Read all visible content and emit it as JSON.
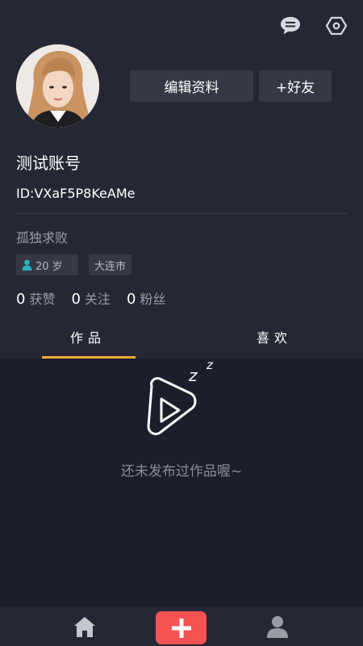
{
  "header": {
    "message_icon": "chat-bubble-icon",
    "settings_icon": "hexagon-settings-icon"
  },
  "profile": {
    "avatar": "user-avatar-photo",
    "edit_button": "编辑资料",
    "add_friend_button": "+好友",
    "nickname": "测试账号",
    "id": "ID:VXaF5P8KeAMe",
    "signature": "孤独求败",
    "age_tag": "20 岁",
    "city_tag": "大连市",
    "stats": [
      {
        "num": "0",
        "label": "获赞"
      },
      {
        "num": "0",
        "label": "关注"
      },
      {
        "num": "0",
        "label": "粉丝"
      }
    ]
  },
  "tabs": [
    {
      "label": "作品",
      "active": true
    },
    {
      "label": "喜欢",
      "active": false
    }
  ],
  "empty_state": {
    "text": "还未发布过作品喔~",
    "icon": "sleeping-play-icon"
  },
  "bottom_nav": {
    "home_icon": "home-icon",
    "add_icon": "plus-icon",
    "me_icon": "person-icon"
  },
  "colors": {
    "background": "#1c1f2b",
    "panel": "#252834",
    "button": "#363945",
    "accent_tab": "#f3a93a",
    "add_button": "#f55353",
    "age_icon": "#2bb3c0"
  }
}
